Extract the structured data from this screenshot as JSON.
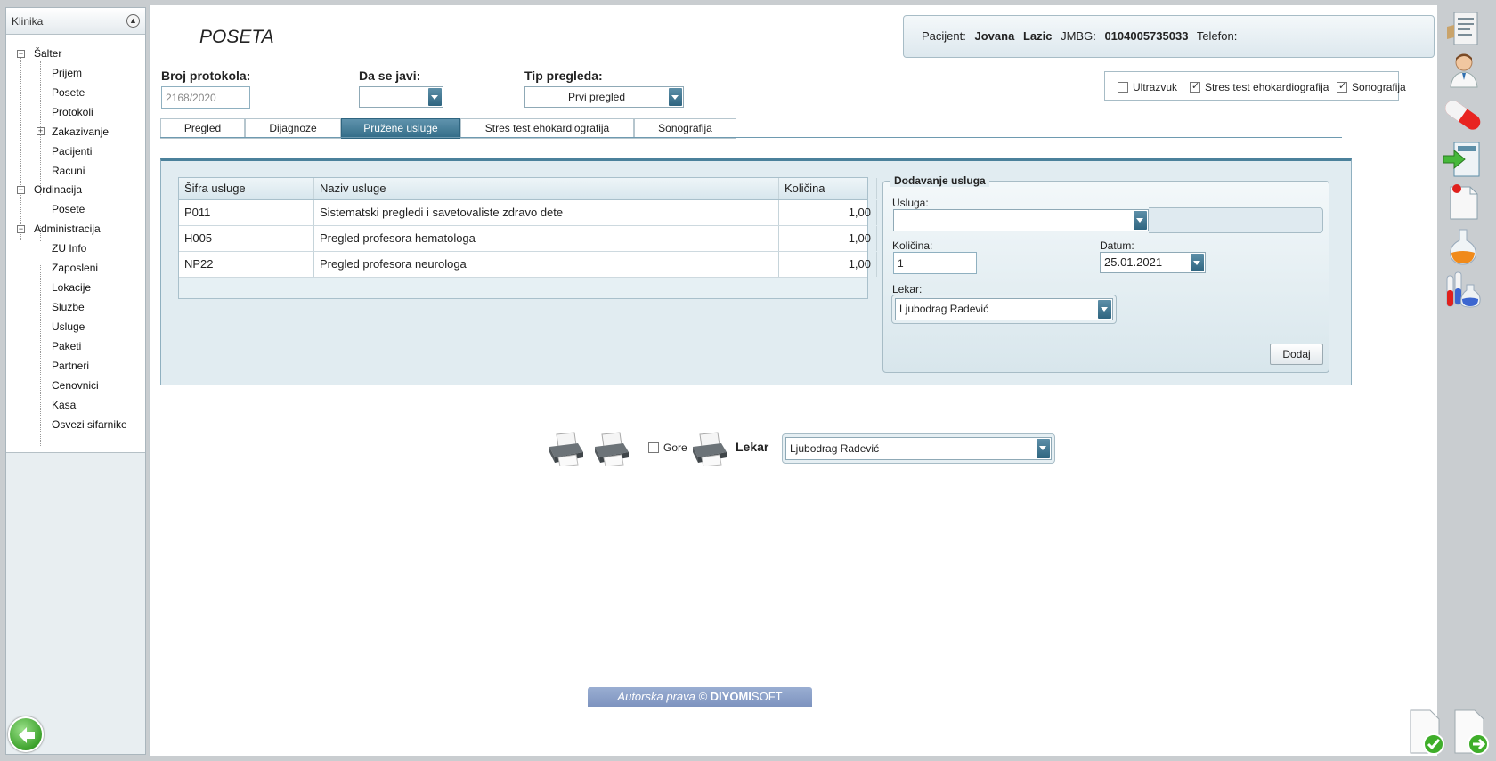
{
  "sidebar": {
    "title": "Klinika",
    "items": [
      {
        "label": "Šalter",
        "level": 0,
        "toggle": "minus"
      },
      {
        "label": "Prijem",
        "level": 1
      },
      {
        "label": "Posete",
        "level": 1
      },
      {
        "label": "Protokoli",
        "level": 1
      },
      {
        "label": "Zakazivanje",
        "level": 1,
        "toggle": "plus"
      },
      {
        "label": "Pacijenti",
        "level": 1
      },
      {
        "label": "Racuni",
        "level": 1
      },
      {
        "label": "Ordinacija",
        "level": 0,
        "toggle": "minus"
      },
      {
        "label": "Posete",
        "level": 1
      },
      {
        "label": "Administracija",
        "level": 0,
        "toggle": "minus"
      },
      {
        "label": "ZU Info",
        "level": 1
      },
      {
        "label": "Zaposleni",
        "level": 1
      },
      {
        "label": "Lokacije",
        "level": 1
      },
      {
        "label": "Sluzbe",
        "level": 1
      },
      {
        "label": "Usluge",
        "level": 1
      },
      {
        "label": "Paketi",
        "level": 1
      },
      {
        "label": "Partneri",
        "level": 1
      },
      {
        "label": "Cenovnici",
        "level": 1
      },
      {
        "label": "Kasa",
        "level": 1
      },
      {
        "label": "Osvezi sifarnike",
        "level": 1
      }
    ]
  },
  "header": {
    "title": "POSETA",
    "patient": {
      "label": "Pacijent:",
      "first_name": "Jovana",
      "last_name": "Lazic",
      "jmbg_label": "JMBG:",
      "jmbg": "0104005735033",
      "phone_label": "Telefon:"
    }
  },
  "form": {
    "protocol_label": "Broj protokola:",
    "protocol_value": "2168/2020",
    "callback_label": "Da se javi:",
    "callback_value": "",
    "exam_type_label": "Tip pregleda:",
    "exam_type_value": "Prvi pregled"
  },
  "checks": [
    {
      "label": "Ultrazvuk",
      "checked": false
    },
    {
      "label": "Stres test ehokardiografija",
      "checked": true
    },
    {
      "label": "Sonografija",
      "checked": true
    }
  ],
  "tabs": [
    {
      "label": "Pregled",
      "active": false
    },
    {
      "label": "Dijagnoze",
      "active": false
    },
    {
      "label": "Pružene usluge",
      "active": true
    },
    {
      "label": "Stres test ehokardiografija",
      "active": false
    },
    {
      "label": "Sonografija",
      "active": false
    }
  ],
  "services_table": {
    "columns": [
      "Šifra usluge",
      "Naziv usluge",
      "Količina"
    ],
    "rows": [
      {
        "code": "P011",
        "name": "Sistematski pregledi i savetovaliste zdravo dete",
        "qty": "1,00"
      },
      {
        "code": "H005",
        "name": "Pregled profesora hematologa",
        "qty": "1,00"
      },
      {
        "code": "NP22",
        "name": "Pregled profesora neurologa",
        "qty": "1,00"
      }
    ]
  },
  "add_service": {
    "legend": "Dodavanje usluga",
    "service_label": "Usluga:",
    "service_value": "",
    "qty_label": "Količina:",
    "qty_value": "1",
    "date_label": "Datum:",
    "date_value": "25.01.2021",
    "doctor_label": "Lekar:",
    "doctor_value": "Ljubodrag Radević",
    "add_button": "Dodaj"
  },
  "print_bar": {
    "gore_label": "Gore",
    "gore_checked": false,
    "doctor_label": "Lekar",
    "doctor_value": "Ljubodrag Radević"
  },
  "footer": {
    "copyright_prefix": "Autorska prava © ",
    "brand_bold": "DIYOMI",
    "brand_rest": "SOFT"
  },
  "icons": {
    "right_bar": [
      "document-icon",
      "doctor-icon",
      "pill-icon",
      "import-icon",
      "pinned-document-icon",
      "flask-icon",
      "test-tubes-icon"
    ],
    "bottom_right": [
      "confirm-document-icon",
      "next-document-icon"
    ],
    "accent": "#336c87",
    "delete_color": "#d9261c"
  }
}
